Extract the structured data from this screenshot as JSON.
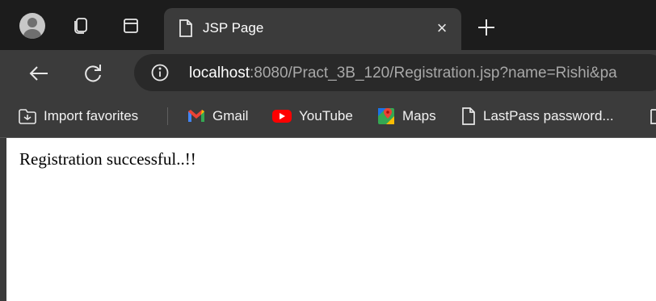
{
  "tab": {
    "title": "JSP Page",
    "close_glyph": "×"
  },
  "address": {
    "host": "localhost",
    "rest": ":8080/Pract_3B_120/Registration.jsp?name=Rishi&pa"
  },
  "bookmarks": [
    {
      "label": "Import favorites",
      "icon": "import-favorites-icon"
    },
    {
      "label": "Gmail",
      "icon": "gmail-icon"
    },
    {
      "label": "YouTube",
      "icon": "youtube-icon"
    },
    {
      "label": "Maps",
      "icon": "maps-icon"
    },
    {
      "label": "LastPass password...",
      "icon": "page-icon"
    }
  ],
  "page": {
    "message": "Registration successful..!!"
  },
  "colors": {
    "tabstrip_bg": "#1c1c1c",
    "toolbar_bg": "#3b3b3b",
    "omnibox_bg": "#292929",
    "url_host": "#ffffff",
    "url_rest": "#a8a8a8",
    "gmail_red": "#ea4335",
    "youtube_red": "#ff0000"
  }
}
